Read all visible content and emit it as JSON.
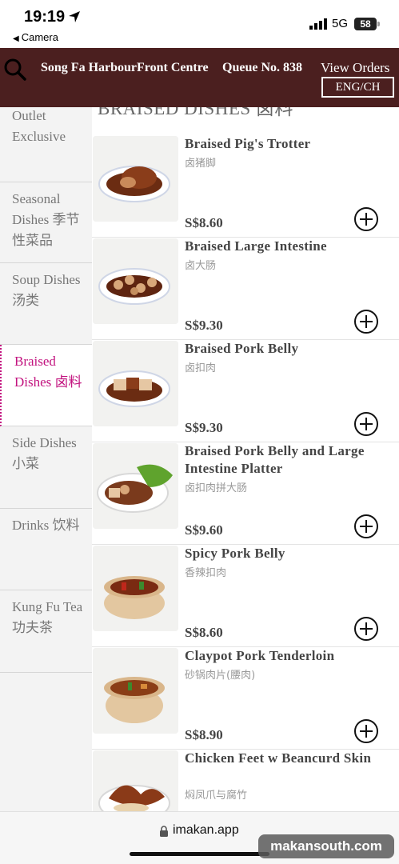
{
  "status_bar": {
    "time": "19:19",
    "back_app": "Camera",
    "network": "5G",
    "battery": "58"
  },
  "header": {
    "store_name": "Song Fa HarbourFront Centre",
    "queue": "Queue No. 838",
    "view_orders": "View Orders",
    "language": "ENG/CH",
    "brand_color": "#4b1f1f"
  },
  "sidebar": {
    "accent_color": "#c2137f",
    "categories": [
      {
        "label": "Outlet Exclusive",
        "active": false
      },
      {
        "label": "Seasonal Dishes 季节性菜品",
        "active": false
      },
      {
        "label": "Soup Dishes 汤类",
        "active": false
      },
      {
        "label": "Braised Dishes 卤料",
        "active": true
      },
      {
        "label": "Side Dishes 小菜",
        "active": false
      },
      {
        "label": "Drinks 饮料",
        "active": false
      },
      {
        "label": "Kung Fu Tea 功夫茶",
        "active": false
      }
    ]
  },
  "main": {
    "section_heading": "BRAISED DISHES 卤料",
    "items": [
      {
        "name": "Braised Pig's Trotter",
        "name_cn": "卤猪脚",
        "price": "S$8.60",
        "image": "braised-trotter-plate"
      },
      {
        "name": "Braised Large Intestine",
        "name_cn": "卤大肠",
        "price": "S$9.30",
        "image": "braised-intestine-plate"
      },
      {
        "name": "Braised Pork Belly",
        "name_cn": "卤扣肉",
        "price": "S$9.30",
        "image": "braised-pork-belly-plate"
      },
      {
        "name": "Braised Pork Belly and Large Intestine Platter",
        "name_cn": "卤扣肉拼大肠",
        "price": "S$9.60",
        "image": "platter-with-lettuce"
      },
      {
        "name": "Spicy Pork Belly",
        "name_cn": "香辣扣肉",
        "price": "S$8.60",
        "image": "claypot-spicy"
      },
      {
        "name": "Claypot Pork Tenderloin",
        "name_cn": "砂锅肉片(腰肉)",
        "price": "S$8.90",
        "image": "claypot-tenderloin"
      },
      {
        "name": "Chicken Feet w Beancurd Skin",
        "name_cn": "焖凤爪与腐竹",
        "price": "",
        "image": "chicken-feet-plate"
      }
    ],
    "add_icon": "plus-circle-icon"
  },
  "bottom_bar": {
    "url": "imakan.app",
    "watermark": "makansouth.com"
  }
}
